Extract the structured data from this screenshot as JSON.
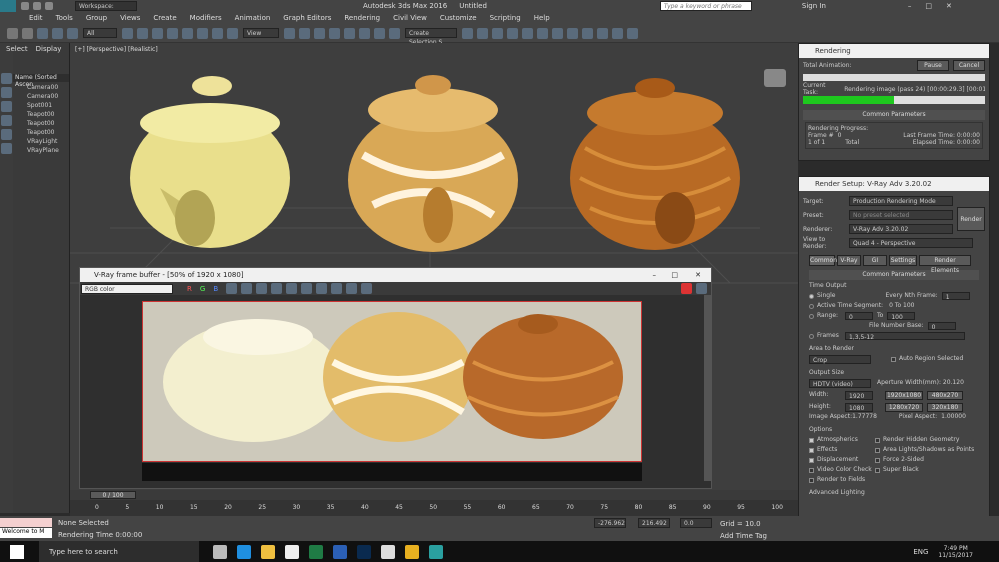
{
  "titlebar": {
    "workspace": "Workspace: Default",
    "app_title": "Autodesk 3ds Max 2016",
    "doc": "Untitled",
    "search_placeholder": "Type a keyword or phrase",
    "signin": "Sign In"
  },
  "menu": [
    "Edit",
    "Tools",
    "Group",
    "Views",
    "Create",
    "Modifiers",
    "Animation",
    "Graph Editors",
    "Rendering",
    "Civil View",
    "Customize",
    "Scripting",
    "Help"
  ],
  "toolbar": {
    "filter": "All",
    "view": "View",
    "selection_set": "Create Selection S"
  },
  "scene": {
    "tabs": [
      "Select",
      "Display"
    ],
    "header": "Name (Sorted Ascen",
    "items": [
      "Camera00",
      "Camera00",
      "Spot001",
      "Teapot00",
      "Teapot00",
      "Teapot00",
      "VRayLight",
      "VRayPlane"
    ]
  },
  "viewport": {
    "label": "[+] [Perspective] [Realistic]"
  },
  "vfb": {
    "title": "V-Ray frame buffer - [50% of 1920 x 1080]",
    "channel": "RGB color",
    "btn_r": "R",
    "btn_g": "G",
    "btn_b": "B"
  },
  "rendering": {
    "title": "Rendering",
    "total_animation": "Total Animation:",
    "pause": "Pause",
    "cancel": "Cancel",
    "current_task": "Current Task:",
    "task_text": "Rendering image (pass 24) [00:00:29.3] [00:01:00.9",
    "progress": 0.5,
    "section": "Common Parameters",
    "rp_label": "Rendering Progress:",
    "frame_label": "Frame #",
    "frame_val": "0",
    "last_frame": "Last Frame Time: 0:00:00",
    "of": "1 of 1",
    "total": "Total",
    "elapsed": "Elapsed Time: 0:00:00"
  },
  "setup": {
    "title": "Render Setup: V-Ray Adv 3.20.02",
    "target_label": "Target:",
    "target": "Production Rendering Mode",
    "preset_label": "Preset:",
    "preset": "No preset selected",
    "renderer_label": "Renderer:",
    "renderer": "V-Ray Adv 3.20.02",
    "view_label": "View to Render:",
    "view": "Quad 4 - Perspective",
    "render_btn": "Render",
    "tabs": [
      "Common",
      "V-Ray",
      "GI",
      "Settings",
      "Render Elements"
    ],
    "common_params": "Common Parameters",
    "time_output": "Time Output",
    "single": "Single",
    "every_nth": "Every Nth Frame:",
    "every_nth_val": "1",
    "active_segment": "Active Time Segment:",
    "active_range": "0 To 100",
    "range": "Range:",
    "range_from": "0",
    "range_to_label": "To",
    "range_to": "100",
    "file_base": "File Number Base:",
    "file_base_val": "0",
    "frames": "Frames",
    "frames_val": "1,3,5-12",
    "area_title": "Area to Render",
    "area": "Crop",
    "auto_region": "Auto Region Selected",
    "output_size": "Output Size",
    "size_preset": "HDTV (video)",
    "aperture": "Aperture Width(mm): 20.120",
    "width_label": "Width:",
    "width": "1920",
    "height_label": "Height:",
    "height": "1080",
    "presets": [
      "1920x1080",
      "480x270",
      "1280x720",
      "320x180"
    ],
    "image_aspect": "Image Aspect:1.77778",
    "pixel_aspect": "Pixel Aspect:",
    "pixel_aspect_val": "1.00000",
    "options": "Options",
    "opt_left": [
      "Atmospherics",
      "Effects",
      "Displacement",
      "Video Color Check",
      "Render to Fields"
    ],
    "opt_right": [
      "Render Hidden Geometry",
      "Area Lights/Shadows as Points",
      "Force 2-Sided",
      "Super Black"
    ],
    "advanced": "Advanced Lighting"
  },
  "timeline": {
    "frame": "0 / 100",
    "ticks": [
      "0",
      "5",
      "10",
      "15",
      "20",
      "25",
      "30",
      "35",
      "40",
      "45",
      "50",
      "55",
      "60",
      "65",
      "70",
      "75",
      "80",
      "85",
      "90",
      "95",
      "100"
    ]
  },
  "status": {
    "maxscript": "Welcome to M",
    "none_selected": "None Selected",
    "render_time": "Rendering Time  0:00:00",
    "x": "-276.962",
    "y": "216.492",
    "z": "0.0",
    "grid": "Grid = 10.0",
    "add_tag": "Add Time Tag"
  },
  "taskbar": {
    "search": "Type here to search",
    "time": "7:49 PM",
    "date": "11/15/2017",
    "lang": "ENG"
  },
  "colors": {
    "accent": "#2a6fd6",
    "progress": "#1ec81e"
  }
}
